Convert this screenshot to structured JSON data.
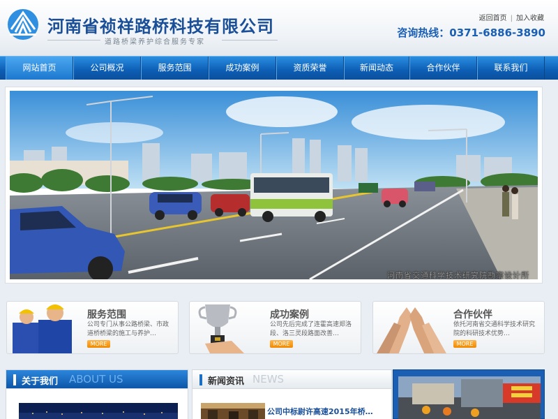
{
  "header": {
    "company_name": "河南省祯祥路桥科技有限公司",
    "tagline": "道路桥梁养护综合服务专家",
    "links": [
      "返回首页",
      "加入收藏"
    ],
    "hotline": "咨询热线：0371-6886-3890"
  },
  "nav": {
    "items": [
      "网站首页",
      "公司概况",
      "服务范围",
      "成功案例",
      "资质荣誉",
      "新闻动态",
      "合作伙伴",
      "联系我们"
    ],
    "active_index": 0
  },
  "banner": {
    "caption": "河南省交通科学技术研究院勘察设计所"
  },
  "features": [
    {
      "title": "服务范围",
      "desc": "公司专门从事公路桥梁、市政道桥桥梁的施工与养护…",
      "more": "MORE"
    },
    {
      "title": "成功案例",
      "desc": "公司先后完成了连霍高速郑洛段、洛三灵段路面改善…",
      "more": "MORE"
    },
    {
      "title": "合作伙伴",
      "desc": "依托河南省交通科学技术研究院的科研技术优势…",
      "more": "MORE"
    }
  ],
  "sections": {
    "about": {
      "title": "关于我们",
      "en": "ABOUT US"
    },
    "news": {
      "title": "新闻资讯",
      "en": "NEWS"
    }
  },
  "news": {
    "items": [
      "公司中标尉许高速2015年桥…"
    ]
  },
  "colors": {
    "brand_blue": "#1a4f98",
    "nav_blue": "#0d5eb5",
    "more_orange": "#f08a00"
  }
}
